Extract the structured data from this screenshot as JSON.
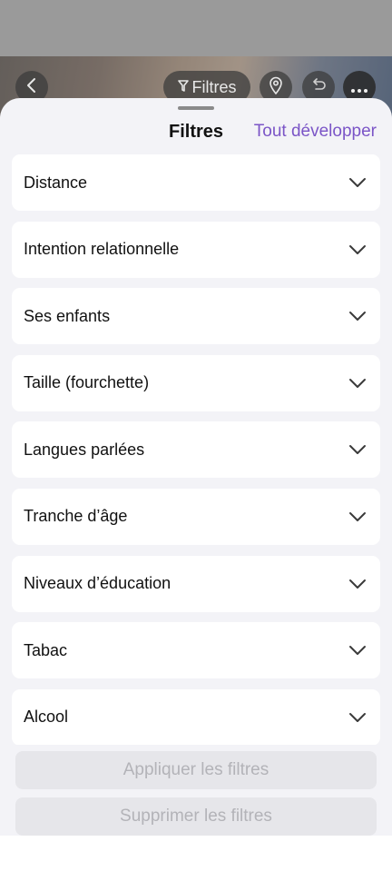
{
  "header": {
    "filters_pill_label": "Filtres",
    "icons": [
      "chevron-left-icon",
      "filter-icon",
      "location-pin-icon",
      "undo-icon",
      "more-icon"
    ]
  },
  "sheet": {
    "title": "Filtres",
    "expand_all_label": "Tout développer",
    "accent_color": "#7b55c7"
  },
  "filters": [
    {
      "label": "Distance"
    },
    {
      "label": "Intention relationnelle"
    },
    {
      "label": "Ses enfants"
    },
    {
      "label": "Taille (fourchette)"
    },
    {
      "label": "Langues parlées"
    },
    {
      "label": "Tranche d’âge"
    },
    {
      "label": "Niveaux d’éducation"
    },
    {
      "label": "Tabac"
    },
    {
      "label": "Alcool"
    }
  ],
  "actions": {
    "apply_label": "Appliquer les filtres",
    "clear_label": "Supprimer les filtres"
  }
}
